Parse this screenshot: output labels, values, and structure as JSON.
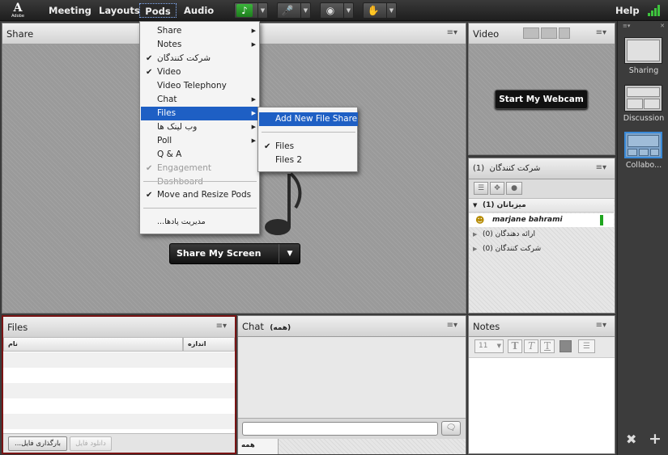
{
  "menubar": {
    "logo_text": "Adobe",
    "items": [
      {
        "label": "Meeting"
      },
      {
        "label": "Layouts"
      },
      {
        "label": "Pods"
      },
      {
        "label": "Audio"
      }
    ],
    "help_label": "Help",
    "toolbar_icons": [
      "speaker-icon",
      "microphone-icon",
      "webcam-icon",
      "raise-hand-icon"
    ]
  },
  "pods_menu": {
    "items": [
      {
        "label": "Share",
        "checked": false,
        "submenu": true
      },
      {
        "label": "Notes",
        "checked": false,
        "submenu": true
      },
      {
        "label": "شرکت کنندگان",
        "checked": true,
        "submenu": false
      },
      {
        "label": "Video",
        "checked": true,
        "submenu": false
      },
      {
        "label": "Video Telephony",
        "checked": false,
        "submenu": false
      },
      {
        "label": "Chat",
        "checked": false,
        "submenu": true
      },
      {
        "label": "Files",
        "checked": false,
        "submenu": true
      },
      {
        "label": "وب لینک ها",
        "checked": false,
        "submenu": true
      },
      {
        "label": "Poll",
        "checked": false,
        "submenu": true
      },
      {
        "label": "Q & A",
        "checked": false,
        "submenu": false
      },
      {
        "label": "Engagement Dashboard",
        "checked": true,
        "submenu": false
      },
      {
        "label": "Move and Resize Pods",
        "checked": true,
        "submenu": false
      },
      {
        "label": "...مدیریت پادها",
        "checked": false,
        "submenu": false
      }
    ],
    "files_submenu": {
      "items": [
        {
          "label": "Add New File Share",
          "checked": false
        },
        {
          "label": "Files",
          "checked": true
        },
        {
          "label": "Files 2",
          "checked": false
        }
      ]
    }
  },
  "share_pod": {
    "title": "Share",
    "share_button_label": "Share My Screen"
  },
  "video_pod": {
    "title": "Video",
    "start_webcam_label": "Start My Webcam"
  },
  "attendees_pod": {
    "title": "شرکت کنندگان",
    "count": "(1)",
    "groups": [
      {
        "label": "(1) میزبانان"
      },
      {
        "label": "(0) ارائه دهندگان"
      },
      {
        "label": "(0) شرکت کنندگان"
      }
    ],
    "host_name": "marjane bahrami"
  },
  "files_pod": {
    "title": "Files",
    "columns": [
      "نام",
      "اندازه"
    ],
    "upload_label": "...بارگذاری فایل",
    "download_label": "دانلود فایل"
  },
  "chat_pod": {
    "title": "Chat",
    "tab": "(همه)",
    "everyone_tab": "همه",
    "input_value": ""
  },
  "notes_pod": {
    "title": "Notes",
    "font_size": "11"
  },
  "layouts_panel": {
    "items": [
      {
        "label": "Sharing"
      },
      {
        "label": "Discussion"
      },
      {
        "label": "Collabo..."
      }
    ]
  }
}
